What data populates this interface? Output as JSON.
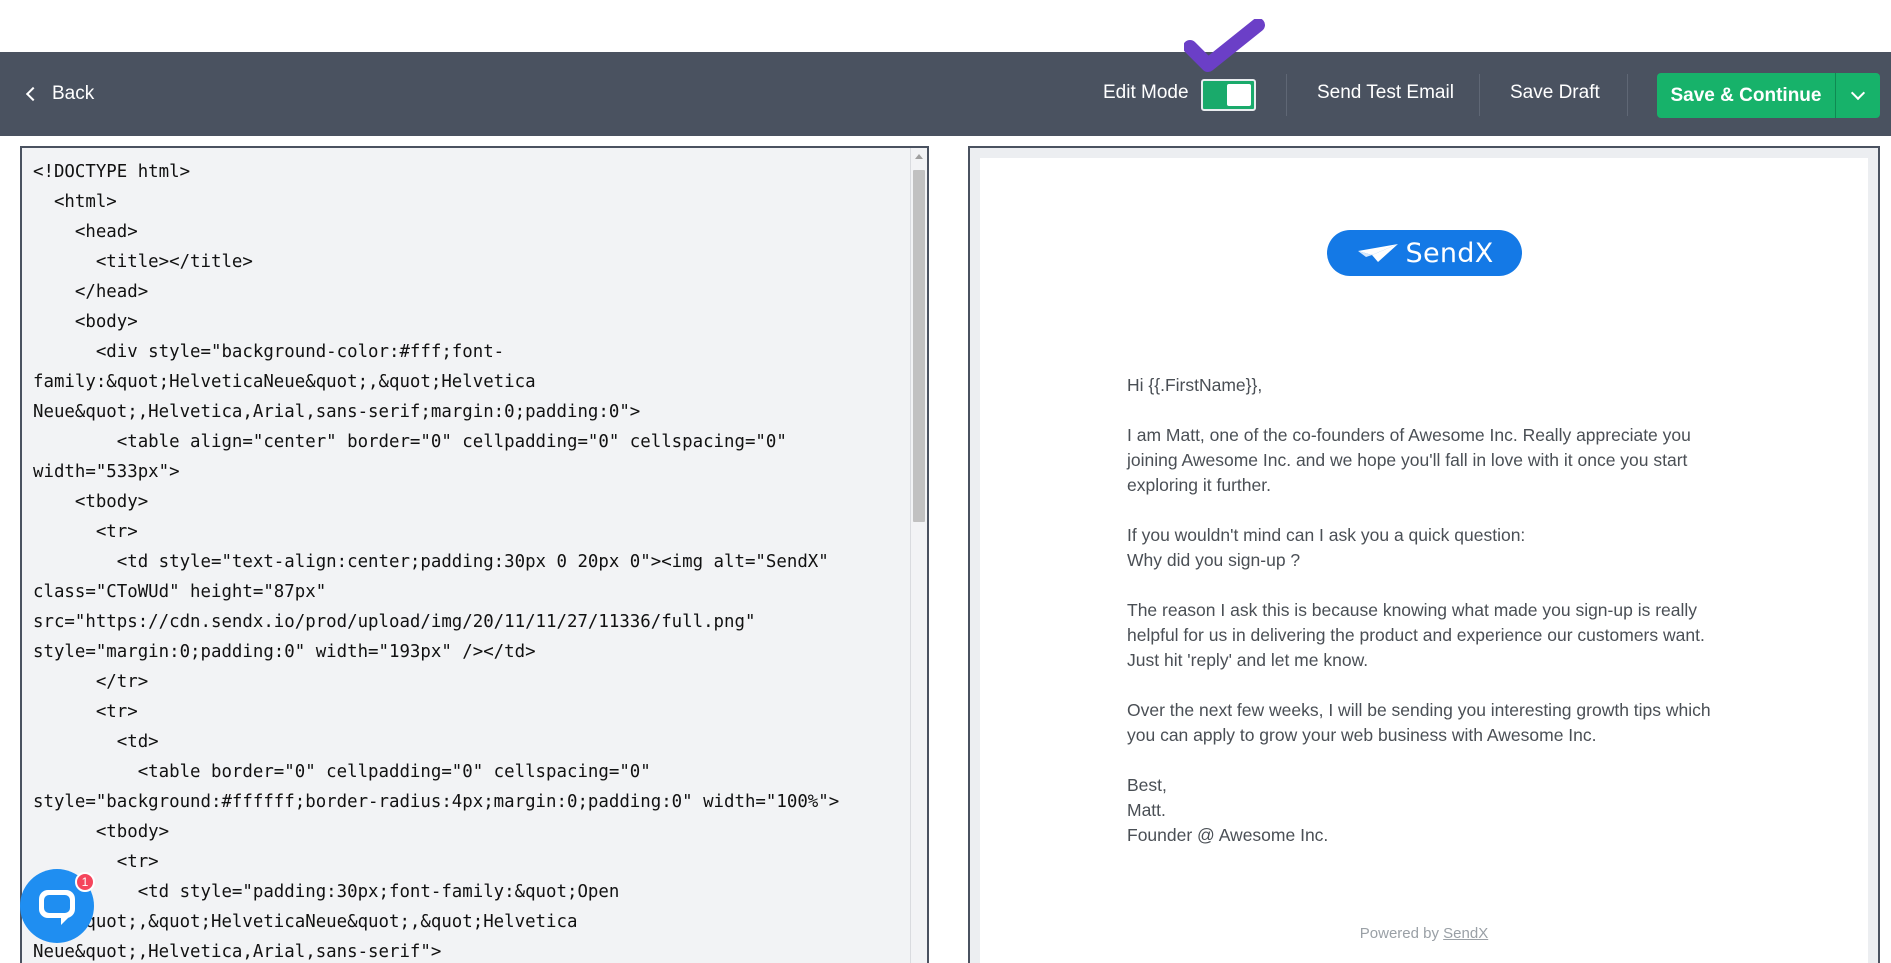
{
  "toolbar": {
    "back_label": "Back",
    "edit_mode_label": "Edit Mode",
    "edit_mode_on": true,
    "send_test_label": "Send Test Email",
    "save_draft_label": "Save Draft",
    "save_continue_label": "Save & Continue"
  },
  "colors": {
    "toolbar_bg": "#4a5260",
    "primary_green": "#17b26a",
    "logo_blue": "#1479e6",
    "chat_blue": "#1f8ef1",
    "checkmark_purple": "#6b3fc7"
  },
  "editor": {
    "code": "<!DOCTYPE html>\n  <html>\n    <head>\n      <title></title>\n    </head>\n    <body>\n      <div style=\"background-color:#fff;font-\nfamily:&quot;HelveticaNeue&quot;,&quot;Helvetica\nNeue&quot;,Helvetica,Arial,sans-serif;margin:0;padding:0\">\n        <table align=\"center\" border=\"0\" cellpadding=\"0\" cellspacing=\"0\"\nwidth=\"533px\">\n    <tbody>\n      <tr>\n        <td style=\"text-align:center;padding:30px 0 20px 0\"><img alt=\"SendX\"\nclass=\"CToWUd\" height=\"87px\"\nsrc=\"https://cdn.sendx.io/prod/upload/img/20/11/11/27/11336/full.png\"\nstyle=\"margin:0;padding:0\" width=\"193px\" /></td>\n      </tr>\n      <tr>\n        <td>\n          <table border=\"0\" cellpadding=\"0\" cellspacing=\"0\"\nstyle=\"background:#ffffff;border-radius:4px;margin:0;padding:0\" width=\"100%\">\n      <tbody>\n        <tr>\n          <td style=\"padding:30px;font-family:&quot;Open\nSans&quot;,&quot;HelveticaNeue&quot;,&quot;Helvetica\nNeue&quot;,Helvetica,Arial,sans-serif\">"
  },
  "preview": {
    "logo_text": "SendX",
    "greeting": "Hi {{.FirstName}},",
    "para1": "I am Matt, one of the co-founders of Awesome Inc. Really appreciate you joining Awesome Inc. and we hope you'll fall in love with it once you start exploring it further.",
    "para2_line1": "If you wouldn't mind can I ask you a quick question:",
    "para2_line2": "Why did you sign-up ?",
    "para3": "The reason I ask this is because knowing what made you sign-up is really helpful for us in delivering the product and experience our customers want. Just hit 'reply' and let me know.",
    "para4": "Over the next few weeks, I will be sending you interesting growth tips which you can apply to grow your web business with Awesome Inc.",
    "sign_best": "Best,",
    "sign_name": "Matt.",
    "sign_title": "Founder @ Awesome Inc.",
    "powered_prefix": "Powered by ",
    "powered_link": "SendX"
  },
  "chat": {
    "badge_count": "1",
    "icon": "chat-bubble-icon"
  }
}
